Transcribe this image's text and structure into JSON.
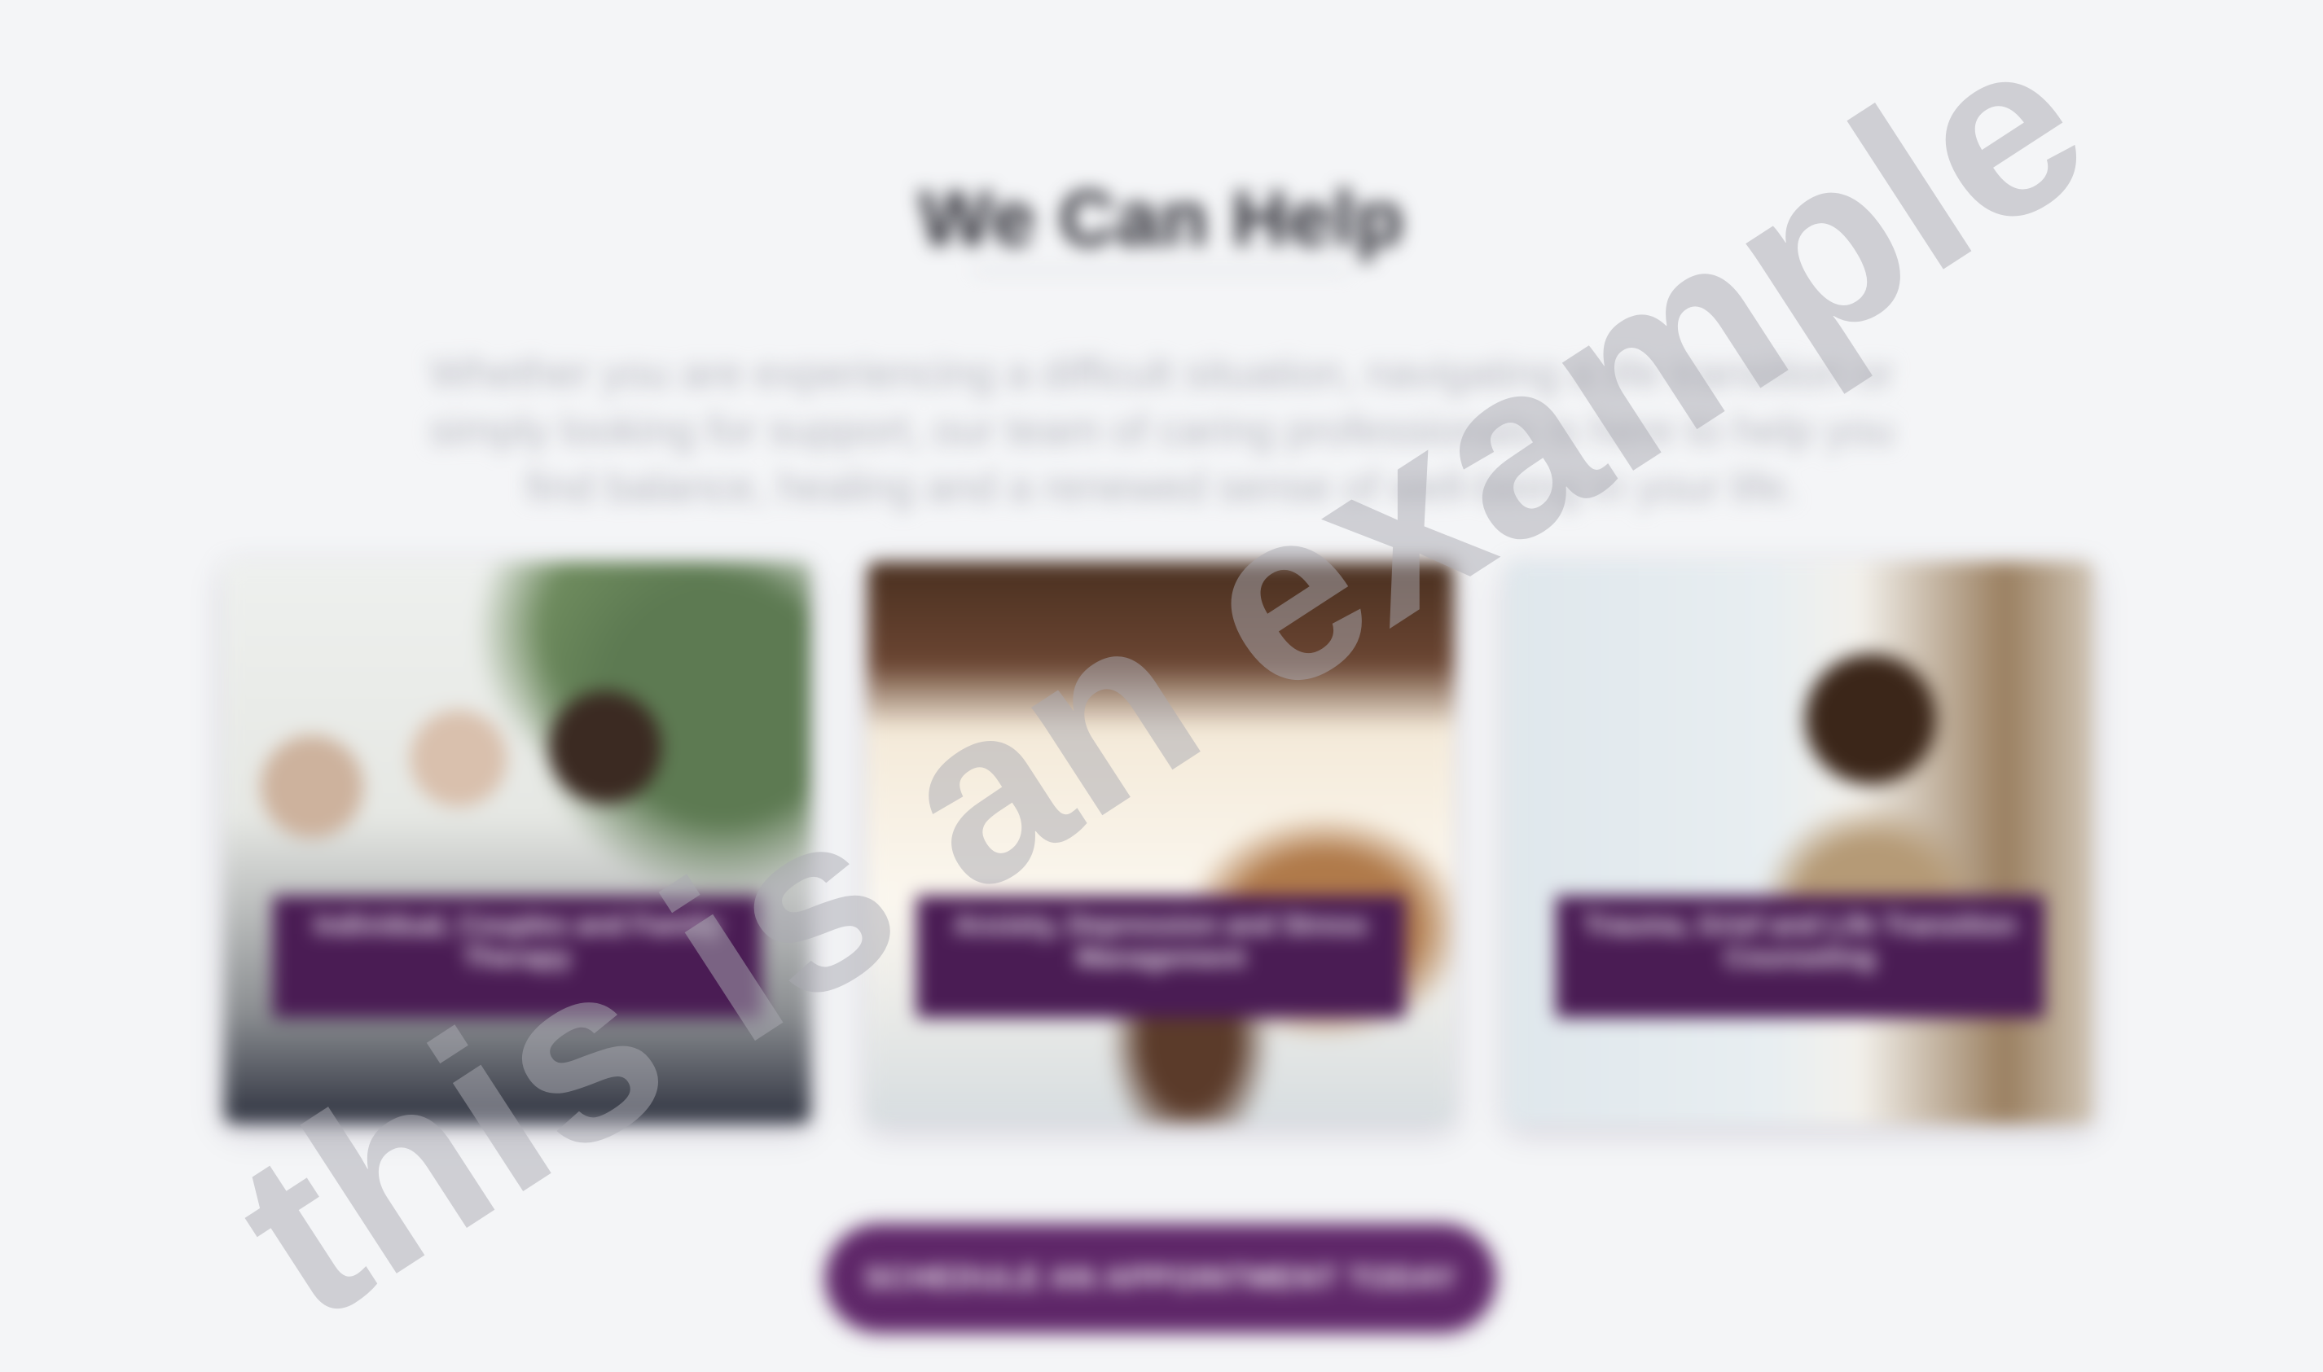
{
  "section": {
    "title": "We Can Help",
    "intro": "Whether you are experiencing a difficult situation, navigating a life transition or simply looking for support, our team of caring professionals is here to help you find balance, healing and a renewed sense of well-being in your life."
  },
  "cards": [
    {
      "caption": "Individual, Couples and Family Therapy"
    },
    {
      "caption": "Anxiety, Depression and Stress Management"
    },
    {
      "caption": "Trauma, Grief and Life Transition Counseling"
    }
  ],
  "cta": {
    "label": "SCHEDULE AN APPOINTMENT TODAY"
  },
  "watermark": {
    "text": "this is an example"
  },
  "colors": {
    "background": "#f4f5f7",
    "brand_purple": "#4a1c54",
    "button_purple": "#5e2668",
    "watermark": "#aaaab2"
  }
}
